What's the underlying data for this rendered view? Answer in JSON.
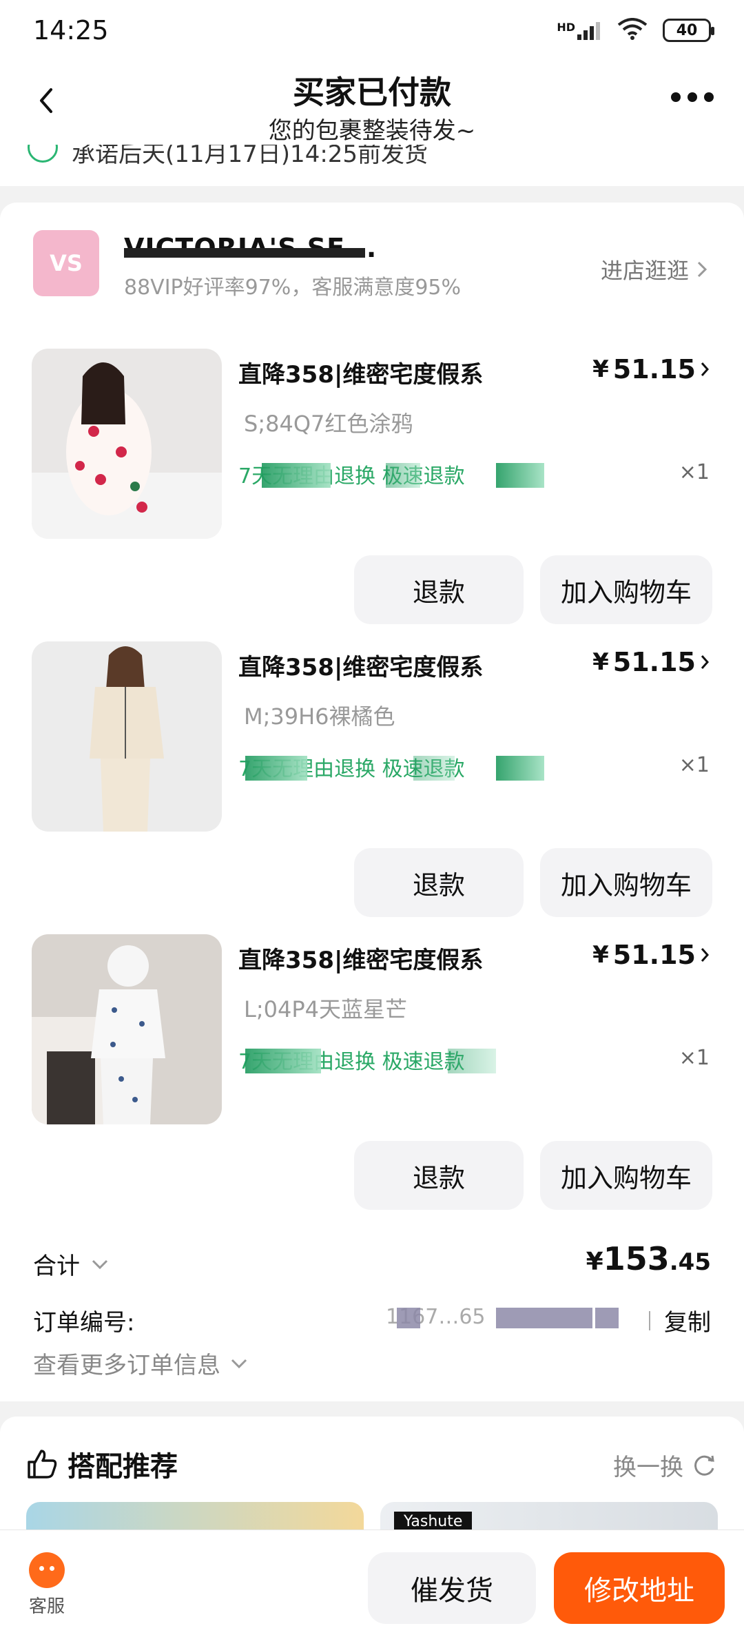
{
  "status_bar": {
    "time": "14:25",
    "battery": "40",
    "network": "HD"
  },
  "nav": {
    "title": "买家已付款",
    "subtitle": "您的包裹整装待发~"
  },
  "promise": {
    "text": "承诺后天(11月17日)14:25前发货"
  },
  "shop": {
    "logo_text": "VS",
    "name": "VICTORIA'S SE...",
    "meta": "88VIP好评率97%，客服满意度95%",
    "visit_label": "进店逛逛"
  },
  "items": [
    {
      "title": "直降358|维密宅度假系",
      "price_currency": "¥",
      "price": "51.15",
      "sku": "S;84Q7红色涂鸦",
      "service": "7天无理由退换  极速退款",
      "qty": "×1",
      "refund_label": "退款",
      "cart_label": "加入购物车"
    },
    {
      "title": "直降358|维密宅度假系",
      "price_currency": "¥",
      "price": "51.15",
      "sku": "M;39H6裸橘色",
      "service": "7天无理由退换  极速退款",
      "qty": "×1",
      "refund_label": "退款",
      "cart_label": "加入购物车"
    },
    {
      "title": "直降358|维密宅度假系",
      "price_currency": "¥",
      "price": "51.15",
      "sku": "L;04P4天蓝星芒",
      "service": "7天无理由退换  极速退款",
      "qty": "×1",
      "refund_label": "退款",
      "cart_label": "加入购物车"
    }
  ],
  "total": {
    "label": "合计",
    "currency": "¥",
    "integer": "153",
    "decimal": ".45"
  },
  "order": {
    "label": "订单编号:",
    "number_visible": "1167…65",
    "copy_label": "复制"
  },
  "more_info": {
    "label": "查看更多订单信息"
  },
  "recommend": {
    "title": "搭配推荐",
    "refresh_label": "换一换",
    "right_brand": "Yashute"
  },
  "bottom": {
    "cs_label": "客服",
    "urge_label": "催发货",
    "modify_label": "修改地址"
  },
  "colors": {
    "accent": "#ff5a0a",
    "service_green": "#2aa866",
    "button_grey": "#f3f3f5"
  }
}
